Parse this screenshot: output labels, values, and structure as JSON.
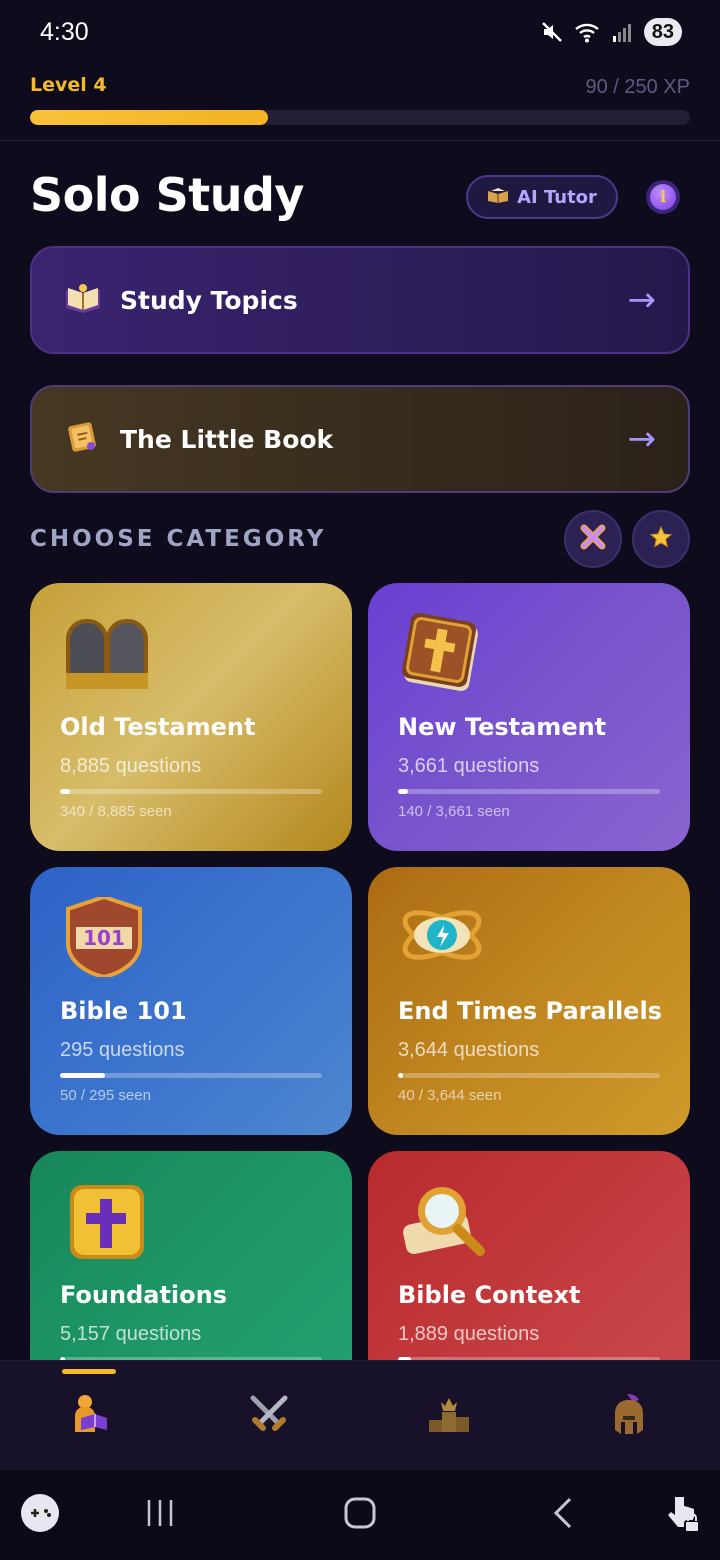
{
  "status": {
    "time": "4:30",
    "battery": "83"
  },
  "level": {
    "label": "Level 4",
    "xp_text": "90 / 250 XP",
    "progress": 0.36
  },
  "header": {
    "title": "Solo Study",
    "ai_tutor_label": "AI Tutor",
    "info_glyph": "i"
  },
  "nav_cards": {
    "study_topics": {
      "label": "Study Topics",
      "arrow": "→"
    },
    "little_book": {
      "label": "The Little Book",
      "arrow": "→"
    }
  },
  "categories_header": {
    "title": "CHOOSE CATEGORY"
  },
  "categories": [
    {
      "name": "Old Testament",
      "count": "8,885 questions",
      "seen": "340 / 8,885 seen",
      "progress": 0.038,
      "icon": "stone-tablets-icon"
    },
    {
      "name": "New Testament",
      "count": "3,661 questions",
      "seen": "140 / 3,661 seen",
      "progress": 0.038,
      "icon": "bible-cross-icon"
    },
    {
      "name": "Bible 101",
      "count": "295 questions",
      "seen": "50 / 295 seen",
      "progress": 0.17,
      "icon": "badge-101-icon"
    },
    {
      "name": "End Times Parallels",
      "count": "3,644 questions",
      "seen": "40 / 3,644 seen",
      "progress": 0.011,
      "icon": "prophecy-eye-icon"
    },
    {
      "name": "Foundations",
      "count": "5,157 questions",
      "seen": "",
      "progress": 0.01,
      "icon": "cross-block-icon"
    },
    {
      "name": "Bible Context",
      "count": "1,889 questions",
      "seen": "",
      "progress": 0.05,
      "icon": "magnifier-scroll-icon"
    }
  ],
  "tabbar": {
    "active": 0,
    "tabs": [
      {
        "icon": "reader-icon"
      },
      {
        "icon": "crossed-swords-icon"
      },
      {
        "icon": "leaderboard-crown-icon"
      },
      {
        "icon": "spartan-helmet-icon"
      }
    ]
  },
  "colors": {
    "accent": "#f6b92a",
    "purple": "#a993ff",
    "bg": "#0e0b1c"
  }
}
